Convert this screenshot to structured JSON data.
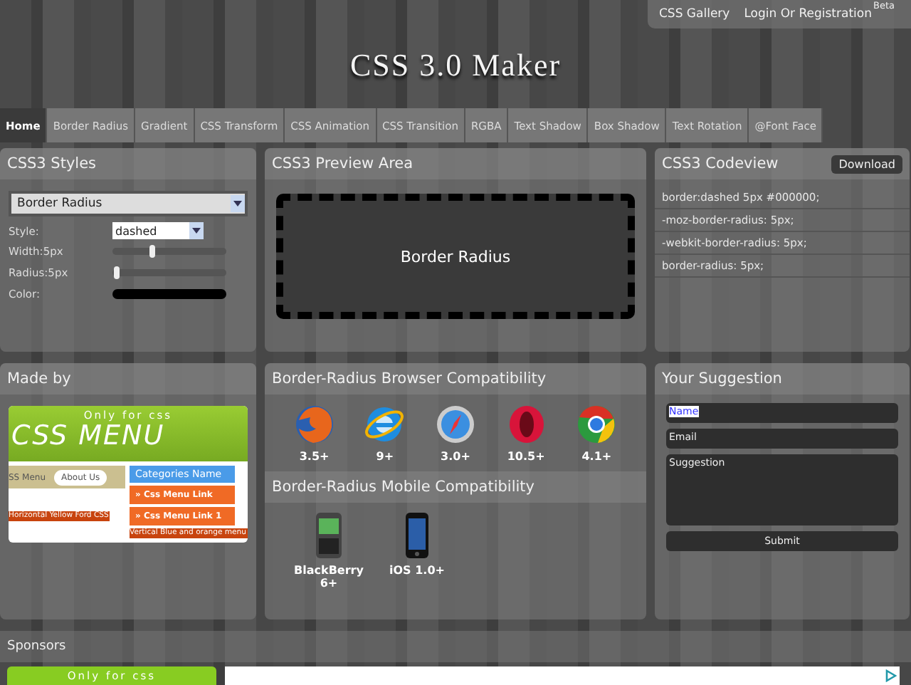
{
  "top_links": [
    {
      "label": "CSS Gallery"
    },
    {
      "label": "Login Or Registration",
      "badge": "Beta"
    }
  ],
  "logo": "CSS 3.0 Maker",
  "tabs": [
    {
      "label": "Home",
      "selected": true
    },
    {
      "label": "Border Radius",
      "selected": false
    },
    {
      "label": "Gradient",
      "selected": false
    },
    {
      "label": "CSS Transform",
      "selected": false
    },
    {
      "label": "CSS Animation",
      "selected": false
    },
    {
      "label": "CSS Transition",
      "selected": false
    },
    {
      "label": "RGBA",
      "selected": false
    },
    {
      "label": "Text Shadow",
      "selected": false
    },
    {
      "label": "Box Shadow",
      "selected": false
    },
    {
      "label": "Text Rotation",
      "selected": false
    },
    {
      "label": "@Font Face",
      "selected": false
    }
  ],
  "styles_panel": {
    "title": "CSS3 Styles",
    "property_select": "Border Radius",
    "rows": [
      {
        "kind": "select",
        "label": "Style:",
        "value": "dashed"
      },
      {
        "kind": "slider",
        "label": "Width:5px",
        "level": 0.35
      },
      {
        "kind": "slider",
        "label": "Radius:5px",
        "level": 0.02
      },
      {
        "kind": "color",
        "label": "Color:",
        "color": "#000000"
      }
    ]
  },
  "preview_panel": {
    "title": "CSS3 Preview Area",
    "preview_text": "Border Radius"
  },
  "code_panel": {
    "title": "CSS3 Codeview",
    "button": "Download",
    "lines": [
      "border:dashed 5px #000000;",
      "-moz-border-radius: 5px;",
      "-webkit-border-radius: 5px;",
      "border-radius: 5px;"
    ]
  },
  "made_by": {
    "title": "Made by",
    "banner": {
      "tagline": "Only for css",
      "headline": "CSS MENU",
      "menu_items": [
        "SS Menu",
        "About Us"
      ],
      "category": "Categories Name",
      "links": [
        "» Css Menu Link",
        "» Css Menu Link 1"
      ],
      "caption_left": "Horizontal Yellow Ford CSS",
      "caption_right": "Vertical Blue and orange menu"
    }
  },
  "browser_panel": {
    "title": "Border-Radius Browser Compatibility",
    "browsers": [
      {
        "kind": "firefox",
        "version": "3.5+"
      },
      {
        "kind": "ie",
        "version": "9+"
      },
      {
        "kind": "safari",
        "version": "3.0+"
      },
      {
        "kind": "opera",
        "version": "10.5+"
      },
      {
        "kind": "chrome",
        "version": "4.1+"
      }
    ]
  },
  "mobile_panel": {
    "title": "Border-Radius Mobile Compatibility",
    "devices": [
      {
        "kind": "blackberry",
        "version": "BlackBerry 6+"
      },
      {
        "kind": "iphone",
        "version": "iOS 1.0+"
      }
    ]
  },
  "suggestion_panel": {
    "title": "Your Suggestion",
    "name_value": "Name",
    "name_highlighted": true,
    "email_value": "Email",
    "suggestion_value": "Suggestion",
    "button": "Submit"
  },
  "sponsors": {
    "title": "Sponsors",
    "banner_tagline": "Only for css"
  }
}
